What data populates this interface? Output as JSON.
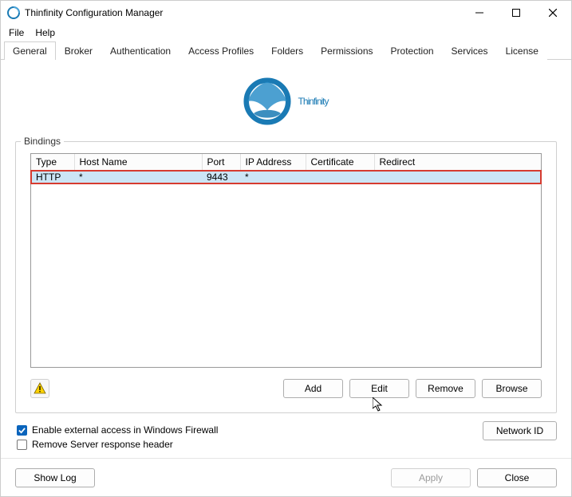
{
  "window": {
    "title": "Thinfinity Configuration Manager"
  },
  "menu": {
    "file": "File",
    "help": "Help"
  },
  "tabs": {
    "general": "General",
    "broker": "Broker",
    "authentication": "Authentication",
    "access_profiles": "Access Profiles",
    "folders": "Folders",
    "permissions": "Permissions",
    "protection": "Protection",
    "services": "Services",
    "license": "License",
    "active": "general"
  },
  "logo": {
    "text": "Thinfinity"
  },
  "bindings": {
    "label": "Bindings",
    "columns": {
      "type": "Type",
      "host": "Host Name",
      "port": "Port",
      "ip": "IP Address",
      "cert": "Certificate",
      "redirect": "Redirect"
    },
    "rows": [
      {
        "type": "HTTP",
        "host": "*",
        "port": "9443",
        "ip": "*",
        "cert": "",
        "redirect": ""
      }
    ],
    "buttons": {
      "add": "Add",
      "edit": "Edit",
      "remove": "Remove",
      "browse": "Browse"
    }
  },
  "options": {
    "firewall": "Enable external access in Windows Firewall",
    "remove_header": "Remove Server response header",
    "firewall_checked": true,
    "remove_header_checked": false,
    "network_id": "Network ID"
  },
  "footer": {
    "show_log": "Show Log",
    "apply": "Apply",
    "close": "Close"
  }
}
